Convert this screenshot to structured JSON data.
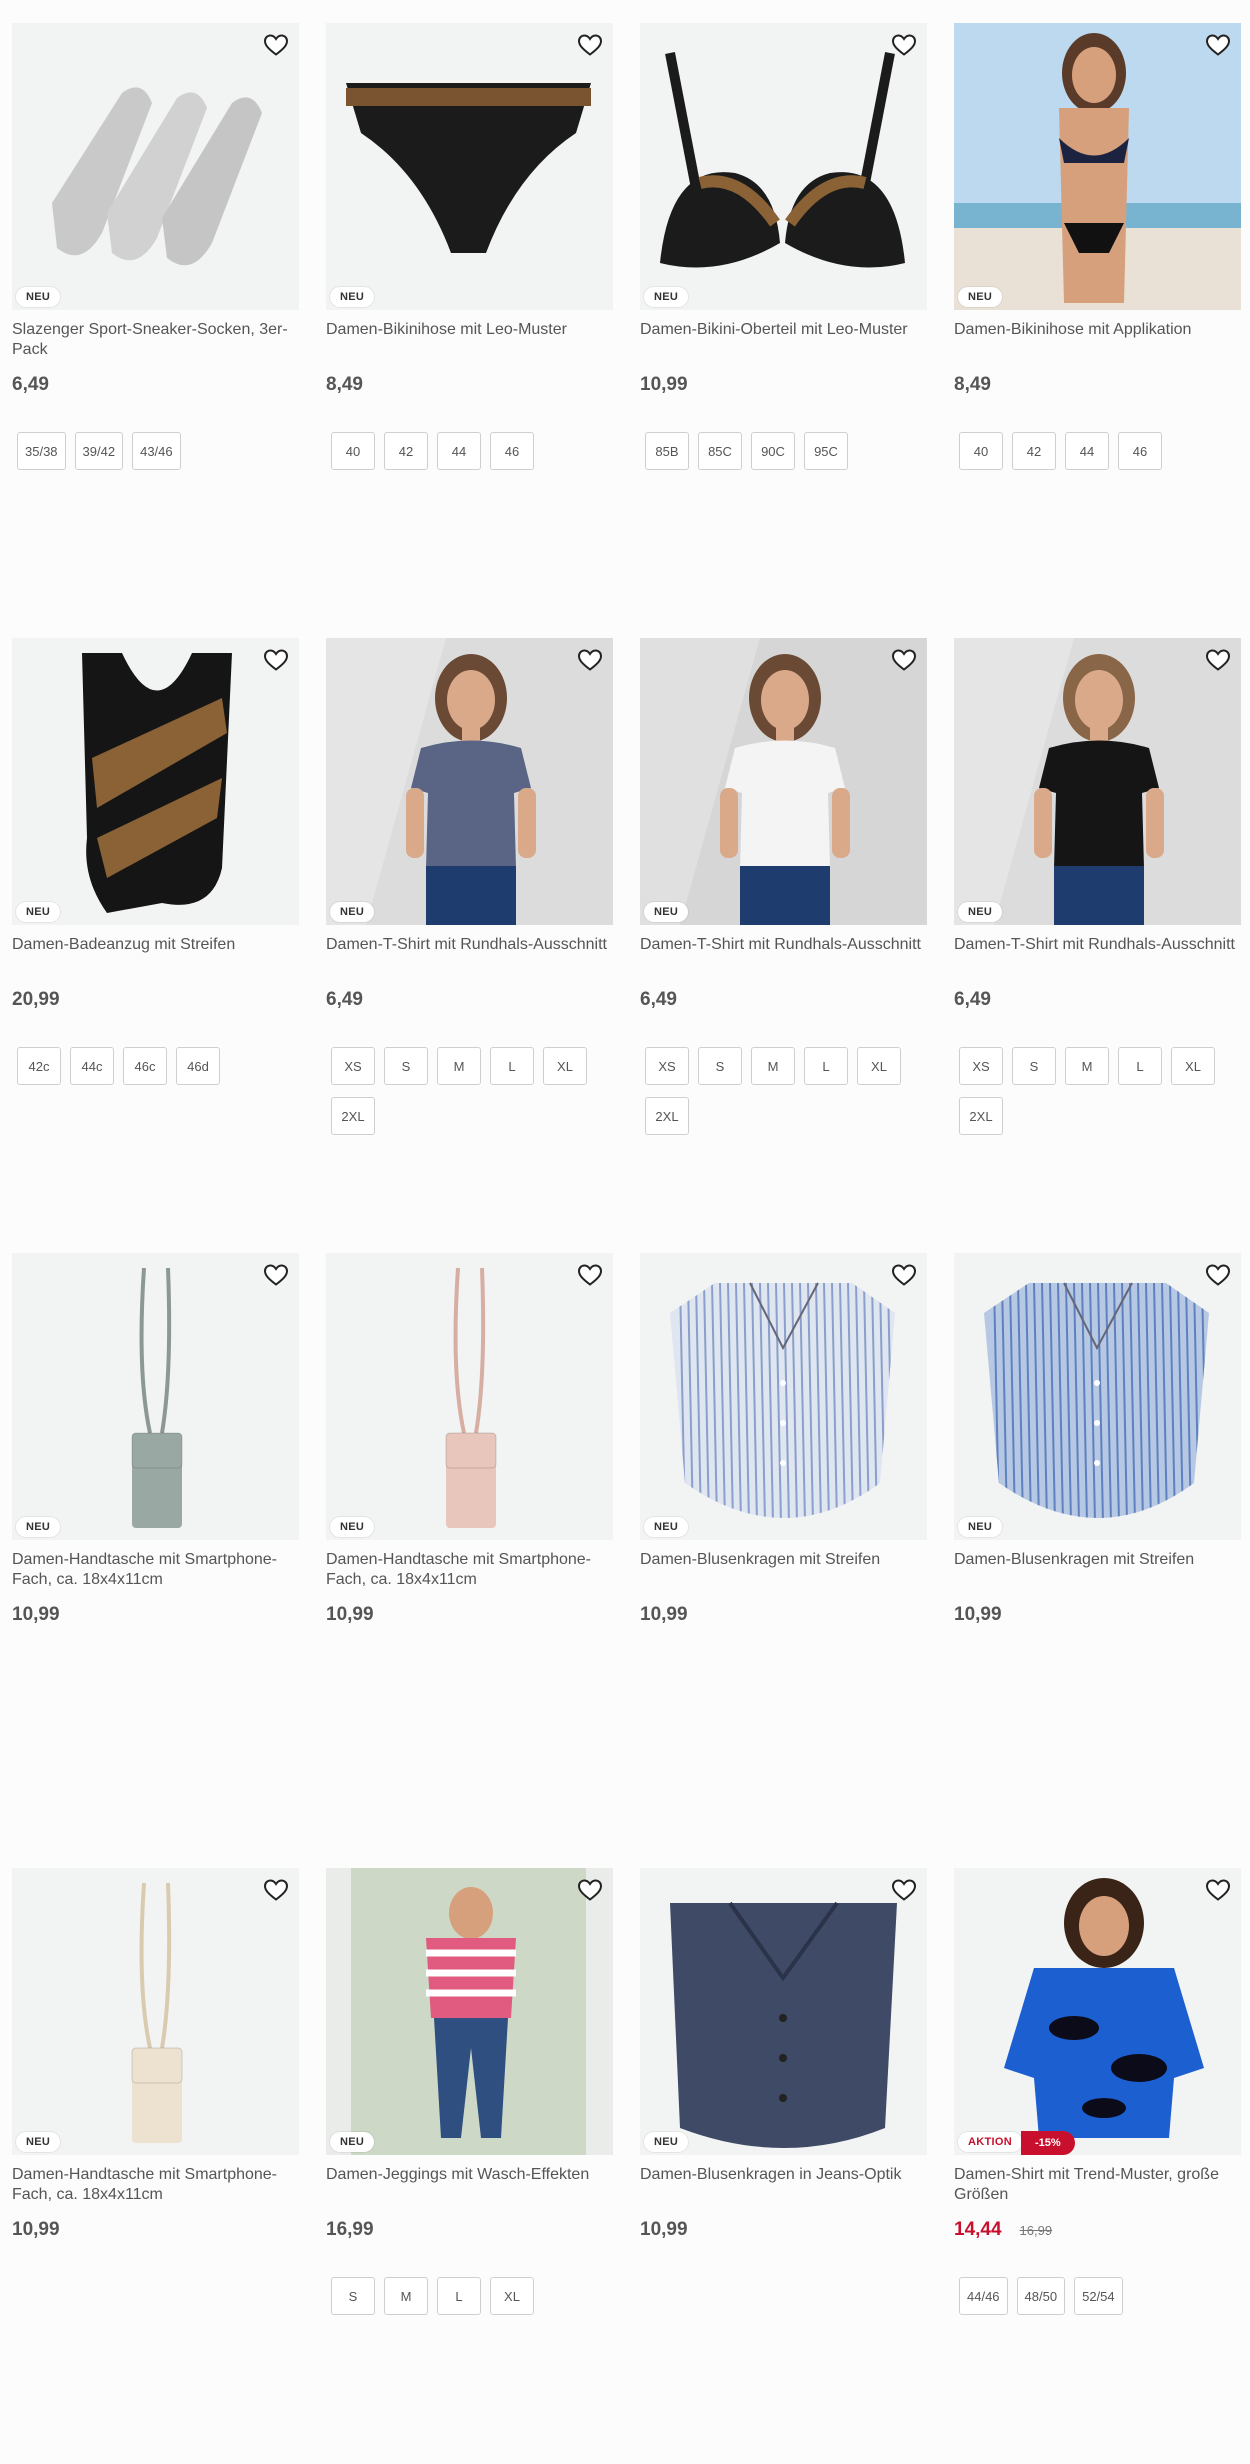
{
  "colors": {
    "accent": "#c8102e",
    "text": "#333333",
    "tile_bg": "#f2f3f3"
  },
  "products": [
    {
      "title": "Slazenger Sport-Sneaker-Socken, 3er-Pack",
      "price": "6,49",
      "badge": "NEU",
      "image": "socks",
      "sizes": [
        "35/38",
        "39/42",
        "43/46"
      ]
    },
    {
      "title": "Damen-Bikinihose mit Leo-Muster",
      "price": "8,49",
      "badge": "NEU",
      "image": "bikini-bottom",
      "sizes": [
        "40",
        "42",
        "44",
        "46"
      ]
    },
    {
      "title": "Damen-Bikini-Oberteil mit Leo-Muster",
      "price": "10,99",
      "badge": "NEU",
      "image": "bikini-top",
      "sizes": [
        "85B",
        "85C",
        "90C",
        "95C"
      ]
    },
    {
      "title": "Damen-Bikinihose mit Applikation",
      "price": "8,49",
      "badge": "NEU",
      "image": "model-bikini",
      "sizes": [
        "40",
        "42",
        "44",
        "46"
      ]
    },
    {
      "title": "Damen-Badeanzug mit Streifen",
      "price": "20,99",
      "badge": "NEU",
      "image": "swimsuit",
      "sizes": [
        "42c",
        "44c",
        "46c",
        "46d"
      ]
    },
    {
      "title": "Damen-T-Shirt mit Rundhals-Ausschnitt",
      "price": "6,49",
      "badge": "NEU",
      "image": "model-tshirt-blue",
      "sizes": [
        "XS",
        "S",
        "M",
        "L",
        "XL",
        "2XL"
      ]
    },
    {
      "title": "Damen-T-Shirt mit Rundhals-Ausschnitt",
      "price": "6,49",
      "badge": "NEU",
      "image": "model-tshirt-white",
      "sizes": [
        "XS",
        "S",
        "M",
        "L",
        "XL",
        "2XL"
      ]
    },
    {
      "title": "Damen-T-Shirt mit Rundhals-Ausschnitt",
      "price": "6,49",
      "badge": "NEU",
      "image": "model-tshirt-black",
      "sizes": [
        "XS",
        "S",
        "M",
        "L",
        "XL",
        "2XL"
      ]
    },
    {
      "title": "Damen-Handtasche mit Smartphone-Fach, ca. 18x4x11cm",
      "price": "10,99",
      "badge": "NEU",
      "image": "bag-mint",
      "sizes": []
    },
    {
      "title": "Damen-Handtasche mit Smartphone-Fach, ca. 18x4x11cm",
      "price": "10,99",
      "badge": "NEU",
      "image": "bag-rose",
      "sizes": []
    },
    {
      "title": "Damen-Blusenkragen mit Streifen",
      "price": "10,99",
      "badge": "NEU",
      "image": "collar-light",
      "sizes": []
    },
    {
      "title": "Damen-Blusenkragen mit Streifen",
      "price": "10,99",
      "badge": "NEU",
      "image": "collar-blue",
      "sizes": []
    },
    {
      "title": "Damen-Handtasche mit Smartphone-Fach, ca. 18x4x11cm",
      "price": "10,99",
      "badge": "NEU",
      "image": "bag-cream",
      "sizes": []
    },
    {
      "title": "Damen-Jeggings mit Wasch-Effekten",
      "price": "16,99",
      "badge": "NEU",
      "image": "model-jeggings",
      "sizes": [
        "S",
        "M",
        "L",
        "XL"
      ]
    },
    {
      "title": "Damen-Blusenkragen in Jeans-Optik",
      "price": "10,99",
      "badge": "NEU",
      "image": "collar-denim",
      "sizes": []
    },
    {
      "title": "Damen-Shirt mit Trend-Muster, große Größen",
      "price": "14,44",
      "old_price": "16,99",
      "badge": "AKTION",
      "discount": "-15%",
      "image": "model-shirt-pattern",
      "sizes": [
        "44/46",
        "48/50",
        "52/54"
      ]
    }
  ]
}
